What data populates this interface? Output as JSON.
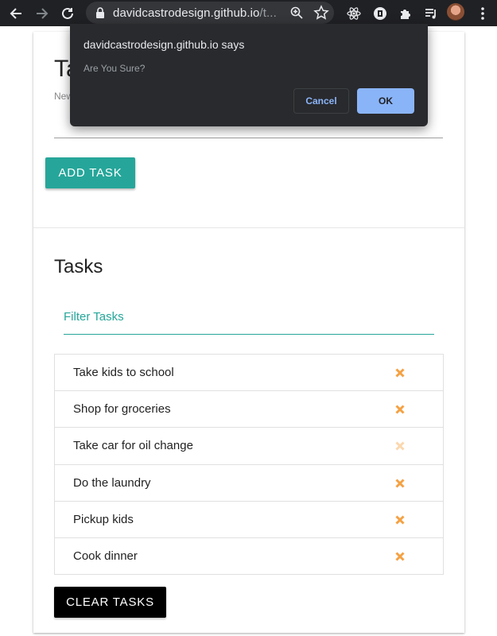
{
  "browser": {
    "url_host": "davidcastrodesign.github.io",
    "url_rest": "/t...",
    "icons": [
      "back-arrow-icon",
      "forward-arrow-icon",
      "reload-icon",
      "lock-icon",
      "zoom-icon",
      "star-icon",
      "react-devtools-icon",
      "extension-icon",
      "puzzle-icon",
      "media-queue-icon",
      "avatar",
      "kebab-menu-icon"
    ]
  },
  "form": {
    "title_visible": "Ta",
    "input_label_visible": "New",
    "add_button": "ADD TASK"
  },
  "tasks": {
    "heading": "Tasks",
    "filter_placeholder": "Filter Tasks",
    "items": [
      {
        "text": "Take kids to school"
      },
      {
        "text": "Shop for groceries"
      },
      {
        "text": "Take car for oil change"
      },
      {
        "text": "Do the laundry"
      },
      {
        "text": "Pickup kids"
      },
      {
        "text": "Cook dinner"
      }
    ],
    "clear_button": "CLEAR TASKS",
    "delete_icon_color": "#f5a143",
    "delete_icon_hover_color": "#fbd8ae"
  },
  "dialog": {
    "title": "davidcastrodesign.github.io says",
    "message": "Are You Sure?",
    "cancel": "Cancel",
    "ok": "OK"
  },
  "colors": {
    "accent_teal": "#26a69a",
    "toolbar_bg": "#202124",
    "dialog_bg": "#292a2d",
    "dialog_link": "#8ab4f8"
  }
}
